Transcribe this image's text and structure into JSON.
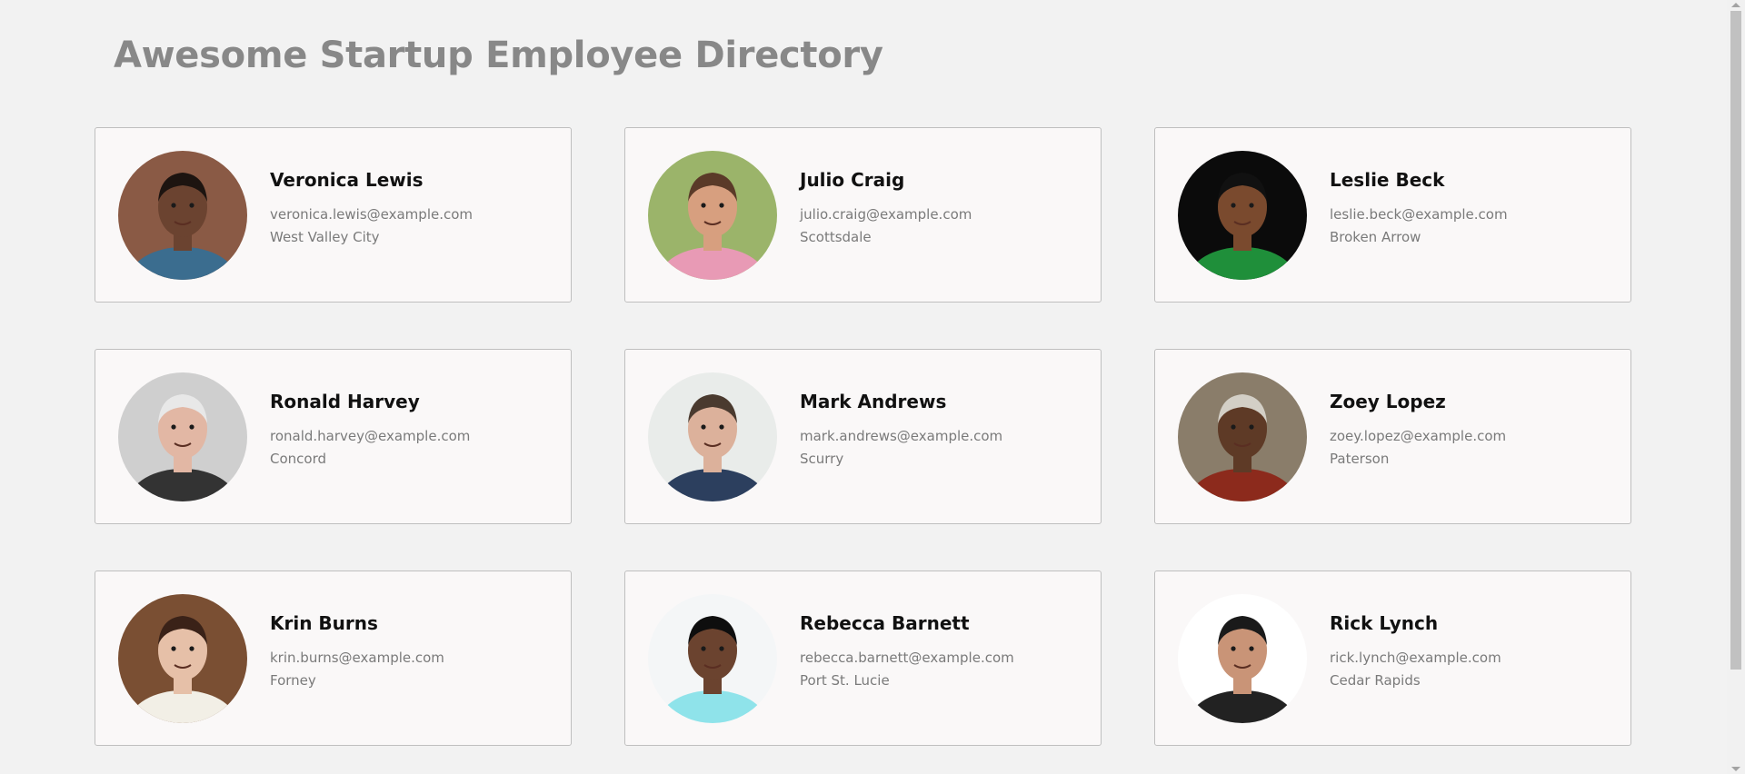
{
  "header": {
    "title": "Awesome Startup Employee Directory"
  },
  "employees": [
    {
      "name": "Veronica Lewis",
      "email": "veronica.lewis@example.com",
      "city": "West Valley City",
      "avatar": {
        "bg": "#8a5a45",
        "skin": "#6b4330",
        "hair": "#1d1410",
        "shirt": "#3b6d8f"
      }
    },
    {
      "name": "Julio Craig",
      "email": "julio.craig@example.com",
      "city": "Scottsdale",
      "avatar": {
        "bg": "#9bb46a",
        "skin": "#d79f7f",
        "hair": "#5a3a28",
        "shirt": "#e89ab5"
      }
    },
    {
      "name": "Leslie Beck",
      "email": "leslie.beck@example.com",
      "city": "Broken Arrow",
      "avatar": {
        "bg": "#0b0b0b",
        "skin": "#7a4a2e",
        "hair": "#111111",
        "shirt": "#1f8f3a"
      }
    },
    {
      "name": "Ronald Harvey",
      "email": "ronald.harvey@example.com",
      "city": "Concord",
      "avatar": {
        "bg": "#cfcfcf",
        "skin": "#e2b7a4",
        "hair": "#e8e8e8",
        "shirt": "#333333"
      }
    },
    {
      "name": "Mark Andrews",
      "email": "mark.andrews@example.com",
      "city": "Scurry",
      "avatar": {
        "bg": "#e9ecea",
        "skin": "#dcb19b",
        "hair": "#4a3a2f",
        "shirt": "#2c3f5e"
      }
    },
    {
      "name": "Zoey Lopez",
      "email": "zoey.lopez@example.com",
      "city": "Paterson",
      "avatar": {
        "bg": "#8a7d6a",
        "skin": "#5e3a26",
        "hair": "#d3cfc6",
        "shirt": "#8c2a1c"
      }
    },
    {
      "name": "Krin Burns",
      "email": "krin.burns@example.com",
      "city": "Forney",
      "avatar": {
        "bg": "#7a4f33",
        "skin": "#e6c0a8",
        "hair": "#3a2218",
        "shirt": "#f2efe6"
      }
    },
    {
      "name": "Rebecca Barnett",
      "email": "rebecca.barnett@example.com",
      "city": "Port St. Lucie",
      "avatar": {
        "bg": "#f4f6f7",
        "skin": "#6b432f",
        "hair": "#0e0e0e",
        "shirt": "#8fe3ea"
      }
    },
    {
      "name": "Rick Lynch",
      "email": "rick.lynch@example.com",
      "city": "Cedar Rapids",
      "avatar": {
        "bg": "#ffffff",
        "skin": "#c99477",
        "hair": "#1a1a1a",
        "shirt": "#222222"
      }
    }
  ]
}
